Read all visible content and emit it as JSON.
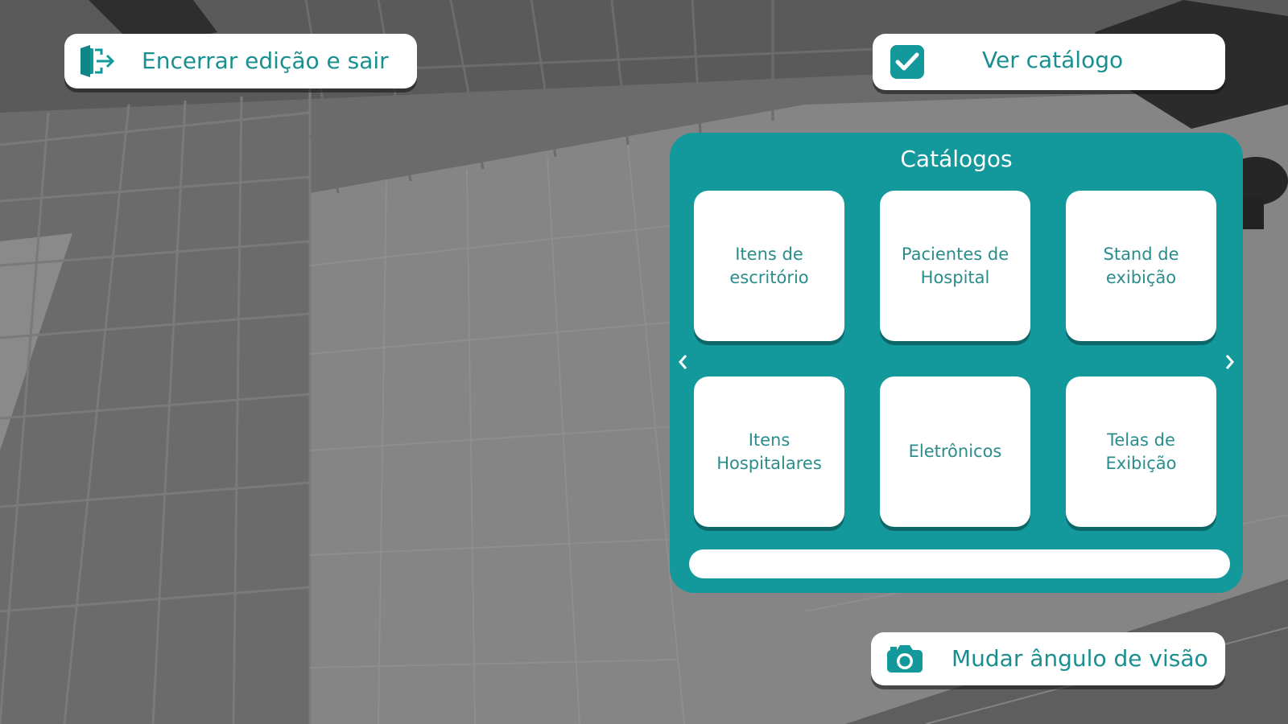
{
  "toolbar": {
    "exit_label": "Encerrar edição e sair",
    "catalog_toggle_label": "Ver catálogo",
    "catalog_toggle_checked": true,
    "camera_label": "Mudar ângulo de visão"
  },
  "catalog": {
    "title": "Catálogos",
    "items": [
      {
        "label": "Itens de escritório"
      },
      {
        "label": "Pacientes de Hospital"
      },
      {
        "label": "Stand de exibição"
      },
      {
        "label": "Itens Hospitalares"
      },
      {
        "label": "Eletrônicos"
      },
      {
        "label": "Telas de Exibição"
      }
    ]
  },
  "icons": {
    "exit": "exit-door-icon",
    "check": "checkbox-checked-icon",
    "camera": "camera-icon",
    "prev": "chevron-left-icon",
    "next": "chevron-right-icon"
  },
  "colors": {
    "accent": "#13999b",
    "text": "#1b8f8f",
    "button_bg": "#ffffff"
  }
}
